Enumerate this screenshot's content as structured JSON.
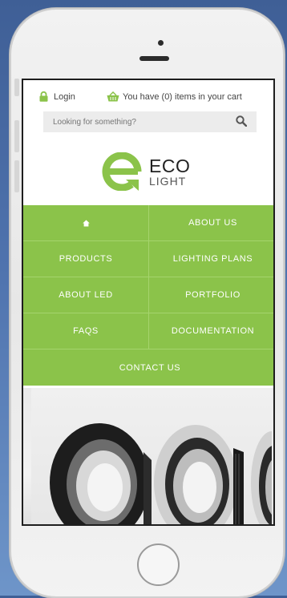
{
  "header": {
    "login_label": "Login",
    "cart_text": "You have (0) items in your cart"
  },
  "search": {
    "placeholder": "Looking for something?"
  },
  "brand": {
    "line1": "ECO",
    "line2": "LIGHT",
    "accent_color": "#8bc34a"
  },
  "nav": {
    "home_icon": "home-icon",
    "about_us": "ABOUT US",
    "products": "PRODUCTS",
    "lighting_plans": "LIGHTING PLANS",
    "about_led": "ABOUT LED",
    "portfolio": "PORTFOLIO",
    "faqs": "FAQS",
    "documentation": "DOCUMENTATION",
    "contact_us": "CONTACT US"
  },
  "hero": {
    "image": "led-downlights-photo"
  },
  "icons": {
    "login": "lock-icon",
    "cart": "basket-icon",
    "search": "search-icon"
  }
}
